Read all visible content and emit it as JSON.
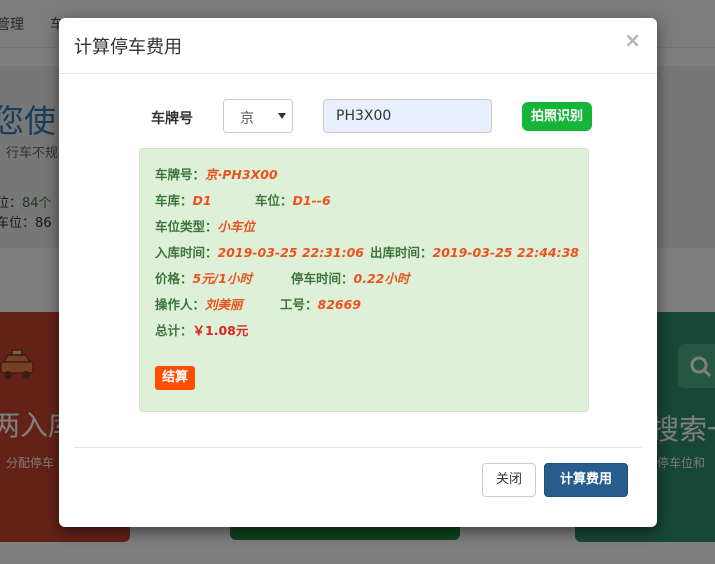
{
  "background": {
    "nav": [
      "管理",
      "车",
      "",
      "",
      ""
    ],
    "hero_title": "您使",
    "hero_subtitle": "行车不规",
    "hero_lines": [
      {
        "label": "位：",
        "value": "84个"
      },
      {
        "label": "车位：",
        "value": "86"
      }
    ],
    "card_left": {
      "title": "两入库",
      "desc": "，分配停车"
    },
    "card_right": {
      "title": "搜索一",
      "desc": "停车位和"
    }
  },
  "modal": {
    "title": "计算停车费用",
    "close_symbol": "×",
    "plate_label": "车牌号",
    "province_value": "京",
    "plate_value": "PH3X00",
    "recognize_button": "拍照识别",
    "info": {
      "plate": {
        "label": "车牌号：",
        "value": "京·PH3X00"
      },
      "garage": {
        "label": "车库：",
        "value": "D1"
      },
      "spot": {
        "label": "车位：",
        "value": "D1--6"
      },
      "spot_type": {
        "label": "车位类型：",
        "value": "小车位"
      },
      "entry_time": {
        "label": "入库时间：",
        "value": "2019-03-25 22:31:06"
      },
      "exit_time": {
        "label": "出库时间：",
        "value": "2019-03-25 22:44:38"
      },
      "price": {
        "label": "价格：",
        "value": "5元/1小时"
      },
      "duration": {
        "label": "停车时间：",
        "value": "0.22小时"
      },
      "operator": {
        "label": "操作人：",
        "value": "刘美丽"
      },
      "employee_id": {
        "label": "工号：",
        "value": "82669"
      },
      "total": {
        "label": "总计：",
        "value": "￥1.08元"
      }
    },
    "settle_button": "结算",
    "footer": {
      "close_button": "关闭",
      "calc_button": "计算费用"
    }
  },
  "colors": {
    "recognize_button": "#17b43a",
    "settle_button": "#ff4d00",
    "primary_button": "#285e8e",
    "panel_bg": "#dff0d8",
    "label_text": "#3c763d",
    "value_text": "#e8531e"
  }
}
